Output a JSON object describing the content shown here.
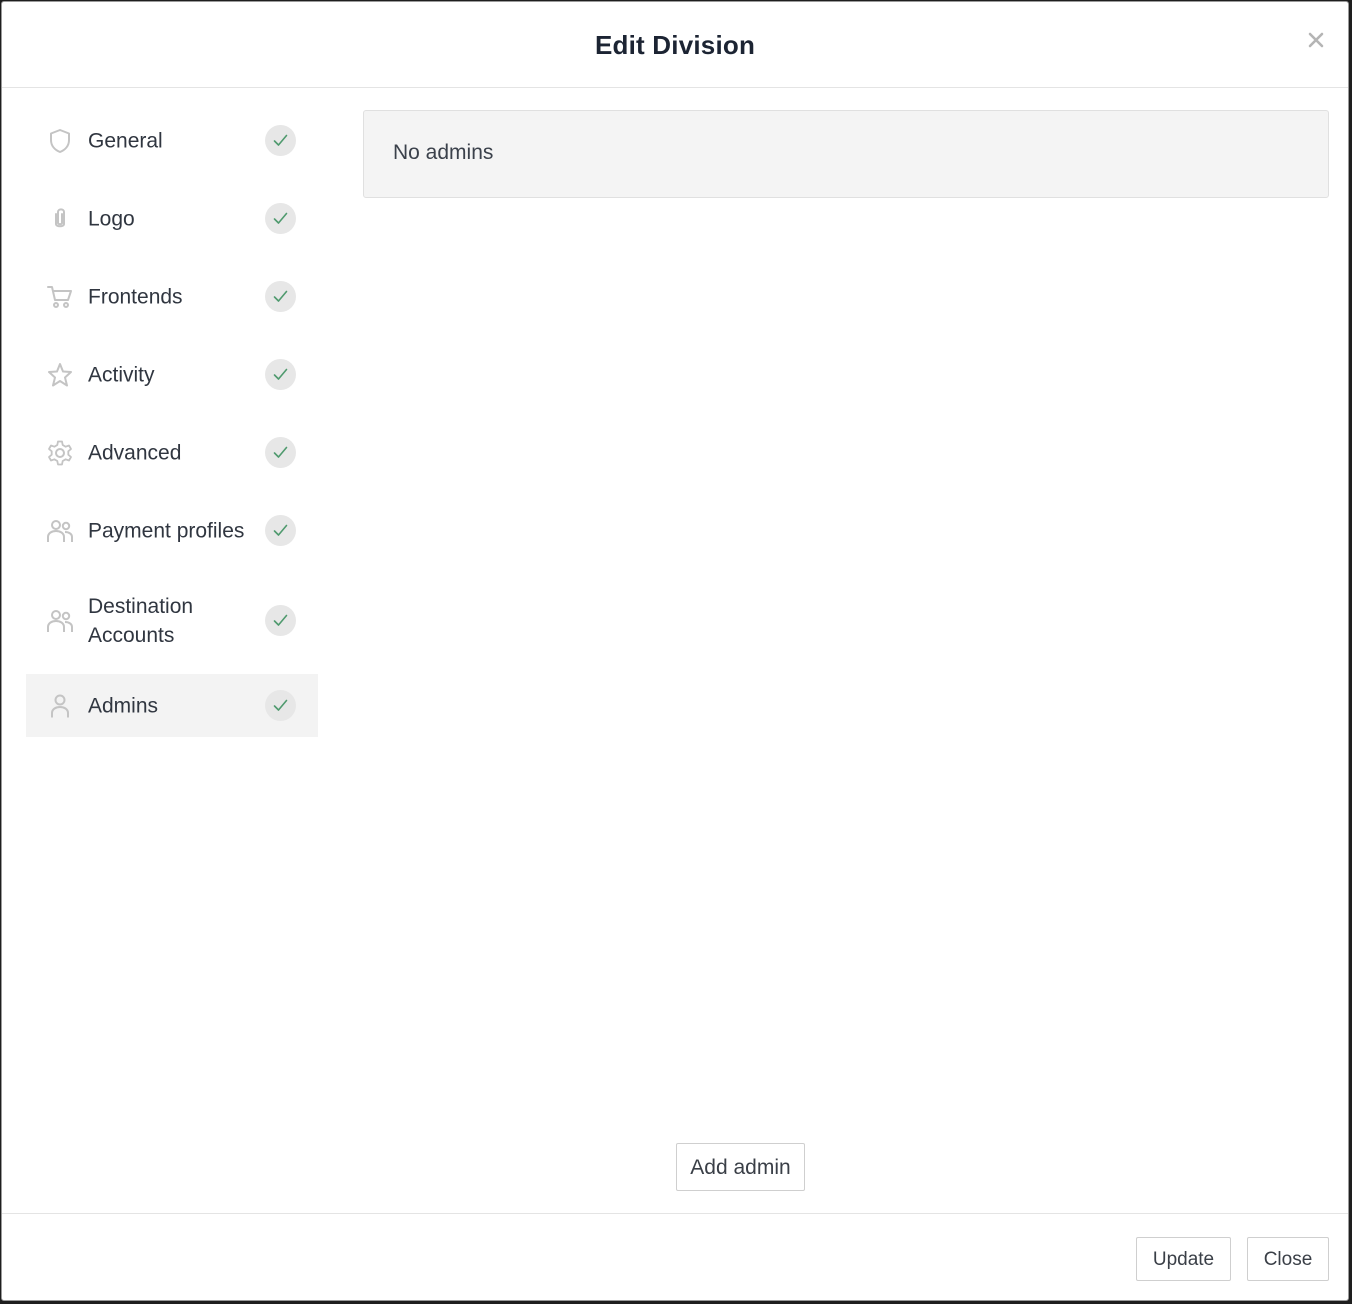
{
  "dialog": {
    "title": "Edit Division"
  },
  "sidebar": {
    "items": [
      {
        "label": "General",
        "icon": "shield-icon",
        "completed": true
      },
      {
        "label": "Logo",
        "icon": "paperclip-icon",
        "completed": true
      },
      {
        "label": "Frontends",
        "icon": "cart-icon",
        "completed": true
      },
      {
        "label": "Activity",
        "icon": "star-icon",
        "completed": true
      },
      {
        "label": "Advanced",
        "icon": "gear-icon",
        "completed": true
      },
      {
        "label": "Payment profiles",
        "icon": "users-icon",
        "completed": true
      },
      {
        "label": "Destination Accounts",
        "icon": "users-icon",
        "completed": true
      },
      {
        "label": "Admins",
        "icon": "user-icon",
        "completed": true,
        "active": true
      }
    ]
  },
  "main": {
    "empty_message": "No admins",
    "add_button": "Add admin"
  },
  "footer": {
    "update_label": "Update",
    "close_label": "Close"
  },
  "colors": {
    "title": "#1c2433",
    "icon": "#c4c4c4",
    "check_bg": "#e7e7e7",
    "check_mark": "#4f9a6e",
    "active_bg": "#f3f3f3"
  }
}
